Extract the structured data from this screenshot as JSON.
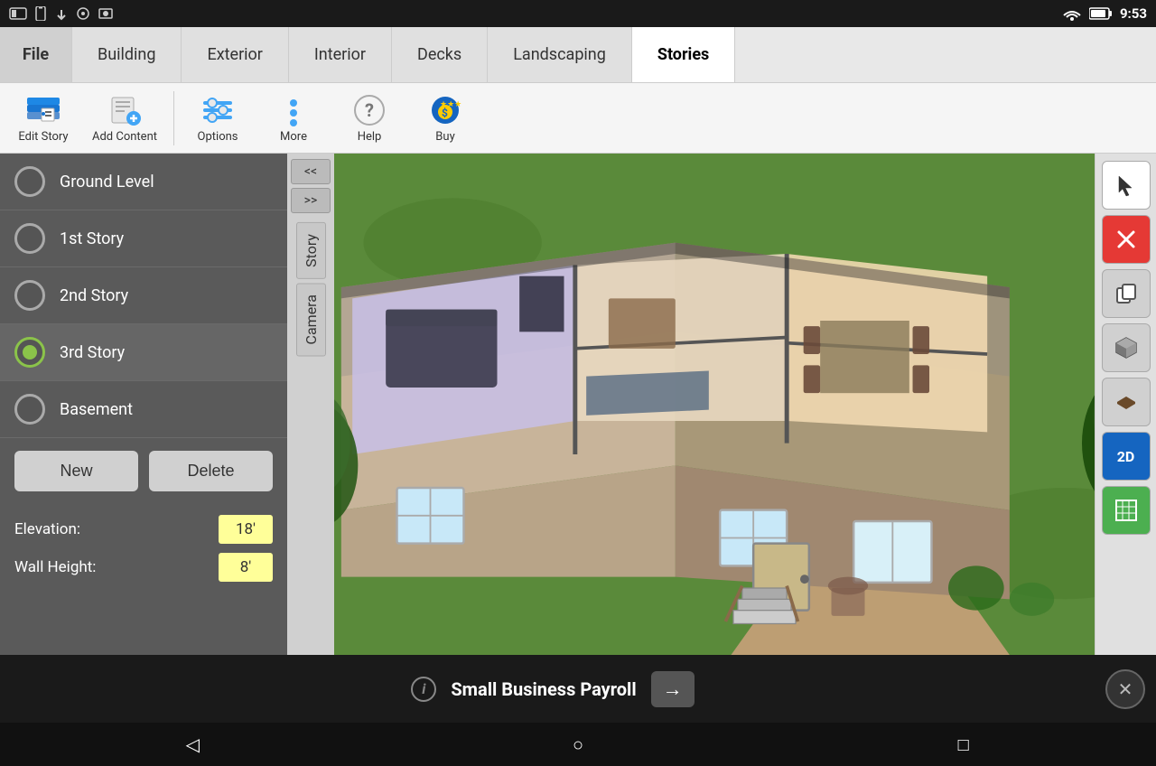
{
  "status_bar": {
    "time": "9:53",
    "icons_left": [
      "tablet-icon",
      "phone-icon",
      "download-icon",
      "settings-icon",
      "camera-icon"
    ],
    "icons_right": [
      "wifi-icon",
      "battery-icon"
    ]
  },
  "tabs": [
    {
      "id": "file",
      "label": "File",
      "active": false
    },
    {
      "id": "building",
      "label": "Building",
      "active": false
    },
    {
      "id": "exterior",
      "label": "Exterior",
      "active": false
    },
    {
      "id": "interior",
      "label": "Interior",
      "active": false
    },
    {
      "id": "decks",
      "label": "Decks",
      "active": false
    },
    {
      "id": "landscaping",
      "label": "Landscaping",
      "active": false
    },
    {
      "id": "stories",
      "label": "Stories",
      "active": true
    }
  ],
  "toolbar": {
    "items": [
      {
        "id": "edit-story",
        "label": "Edit Story"
      },
      {
        "id": "add-content",
        "label": "Add Content"
      },
      {
        "id": "options",
        "label": "Options"
      },
      {
        "id": "more",
        "label": "More"
      },
      {
        "id": "help",
        "label": "Help"
      },
      {
        "id": "buy",
        "label": "Buy"
      }
    ]
  },
  "stories_panel": {
    "items": [
      {
        "id": "ground-level",
        "label": "Ground Level",
        "selected": false
      },
      {
        "id": "1st-story",
        "label": "1st Story",
        "selected": false
      },
      {
        "id": "2nd-story",
        "label": "2nd Story",
        "selected": false
      },
      {
        "id": "3rd-story",
        "label": "3rd Story",
        "selected": true
      },
      {
        "id": "basement",
        "label": "Basement",
        "selected": false
      }
    ],
    "buttons": {
      "new": "New",
      "delete": "Delete"
    },
    "elevation": {
      "label": "Elevation:",
      "value": "18'"
    },
    "wall_height": {
      "label": "Wall Height:",
      "value": "8'"
    }
  },
  "side_tabs": {
    "arrows": [
      "<<",
      ">>"
    ],
    "story_tab": "Story",
    "camera_tab": "Camera"
  },
  "right_toolbar": {
    "tools": [
      {
        "id": "select",
        "symbol": "↖"
      },
      {
        "id": "delete",
        "symbol": "✕"
      },
      {
        "id": "copy",
        "symbol": "⧉"
      },
      {
        "id": "cube",
        "symbol": "⬛"
      },
      {
        "id": "floor",
        "symbol": "◼"
      },
      {
        "id": "2d-view",
        "label": "2D"
      },
      {
        "id": "grid",
        "symbol": "⊞"
      }
    ]
  },
  "bottom_bar": {
    "ad_text": "Small Business Payroll",
    "info_icon": "i",
    "arrow_symbol": "→",
    "close_symbol": "✕"
  },
  "android_nav": {
    "back": "◁",
    "home": "○",
    "recent": "□"
  }
}
